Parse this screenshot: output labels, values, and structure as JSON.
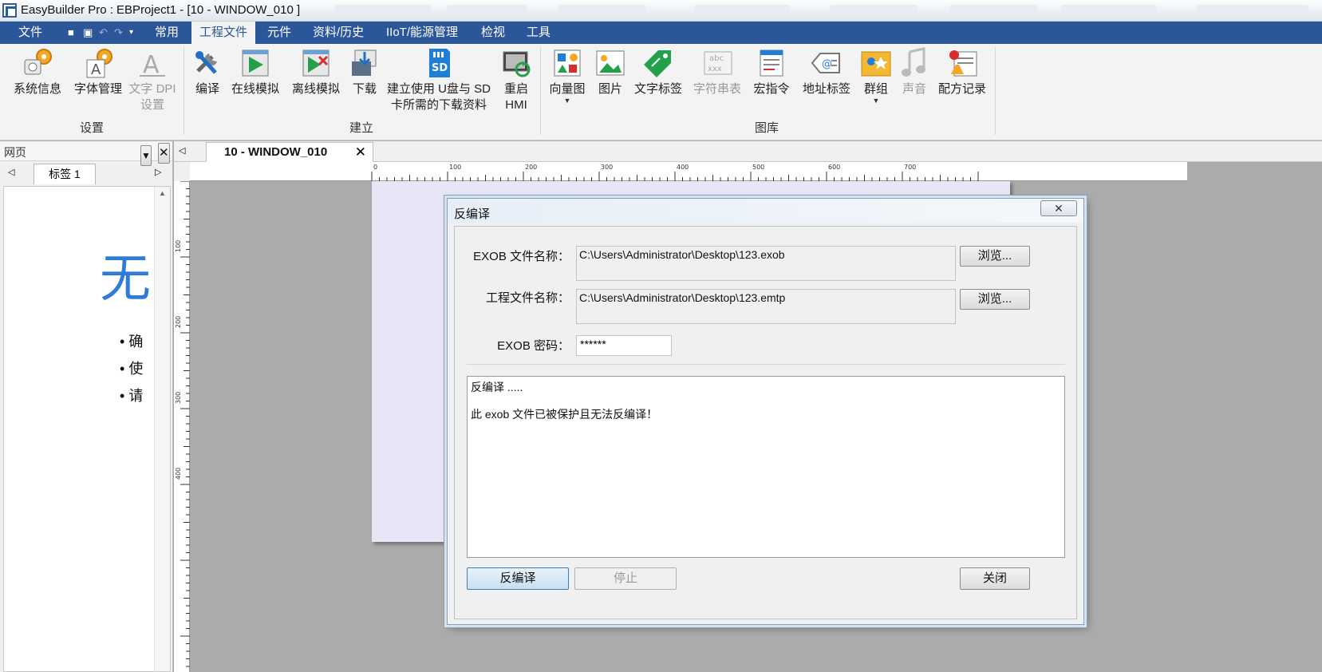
{
  "window": {
    "title": "EasyBuilder Pro : EBProject1 - [10 - WINDOW_010 ]"
  },
  "menu": {
    "items": [
      "文件",
      "常用",
      "工程文件",
      "元件",
      "资料/历史",
      "IIoT/能源管理",
      "检视",
      "工具"
    ],
    "active": "工程文件"
  },
  "ribbon": {
    "groups": [
      {
        "label": "设置",
        "buttons": [
          "系统信息",
          "字体管理",
          "文字 DPI\n设置"
        ]
      },
      {
        "label": "建立",
        "buttons": [
          "编译",
          "在线模拟",
          "离线模拟",
          "下载",
          "建立使用 U盘与 SD\n卡所需的下载资料",
          "重启\nHMI"
        ]
      },
      {
        "label": "图库",
        "buttons": [
          "向量图",
          "图片",
          "文字标签",
          "字符串表",
          "宏指令",
          "地址标签",
          "群组",
          "声音",
          "配方记录"
        ]
      }
    ],
    "b": {
      "sysinfo": "系统信息",
      "font": "字体管理",
      "dpi1": "文字 DPI",
      "dpi2": "设置",
      "compile": "编译",
      "online": "在线模拟",
      "offline": "离线模拟",
      "download": "下载",
      "usb1": "建立使用 U盘与 SD",
      "usb2": "卡所需的下载资料",
      "reboot1": "重启",
      "reboot2": "HMI",
      "vector": "向量图",
      "picture": "图片",
      "textlabel": "文字标签",
      "strtable": "字符串表",
      "macro": "宏指令",
      "addrlabel": "地址标签",
      "group": "群组",
      "sound": "声音",
      "recipe": "配方记录",
      "g_settings": "设置",
      "g_build": "建立",
      "g_library": "图库"
    }
  },
  "left_pane": {
    "title": "网页",
    "tab": "标签 1",
    "big_char": "无",
    "bullets": [
      "确",
      "使",
      "请"
    ]
  },
  "doc_tab": {
    "label": "10 - WINDOW_010"
  },
  "ruler": {
    "h_labels": [
      "0",
      "100",
      "200",
      "300",
      "400",
      "500",
      "600",
      "700"
    ],
    "v_labels": [
      "100",
      "200",
      "300",
      "400"
    ]
  },
  "dialog": {
    "title": "反编译",
    "exob_label": "EXOB 文件名称：",
    "exob_value": "C:\\Users\\Administrator\\Desktop\\123.exob",
    "browse1": "浏览...",
    "proj_label": "工程文件名称：",
    "proj_value": "C:\\Users\\Administrator\\Desktop\\123.emtp",
    "browse2": "浏览...",
    "pw_label": "EXOB 密码：",
    "pw_value": "******",
    "log_line1": "反编译 .....",
    "log_line2": "此 exob 文件已被保护且无法反编译！",
    "btn_decompile": "反编译",
    "btn_stop": "停止",
    "btn_close": "关闭"
  }
}
